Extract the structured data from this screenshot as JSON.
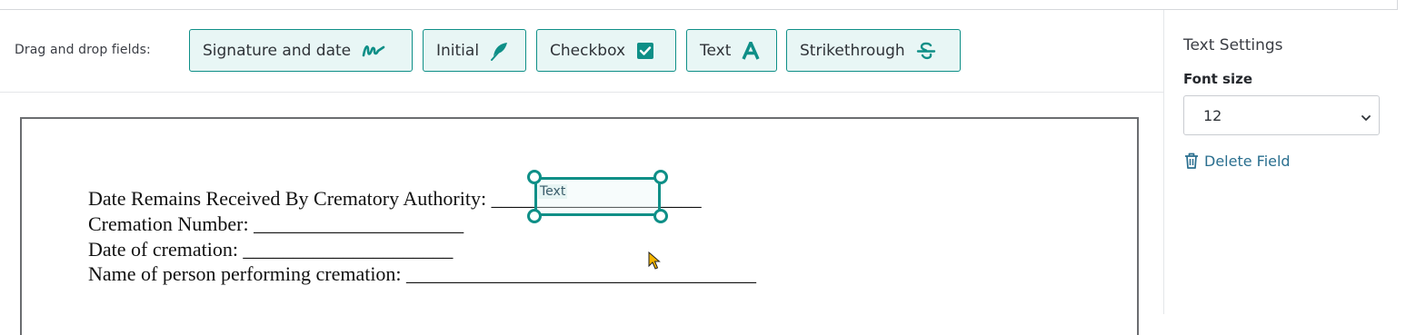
{
  "toolbar": {
    "label": "Drag and drop fields:",
    "fields": [
      {
        "label": "Signature and date",
        "icon": "signature-icon"
      },
      {
        "label": "Initial",
        "icon": "feather-icon"
      },
      {
        "label": "Checkbox",
        "icon": "checkbox-icon"
      },
      {
        "label": "Text",
        "icon": "text-a-icon"
      },
      {
        "label": "Strikethrough",
        "icon": "strikethrough-icon"
      }
    ]
  },
  "document": {
    "lines": [
      "Date Remains Received By Crematory Authority: _____________________",
      "Cremation Number: _____________________",
      "Date of cremation: _____________________",
      "Name of person performing cremation: ___________________________________"
    ],
    "placed_field": {
      "type": "Text",
      "placeholder": "Text"
    }
  },
  "settings": {
    "title": "Text Settings",
    "font_size_label": "Font size",
    "font_size_value": "12",
    "delete_label": "Delete Field"
  },
  "colors": {
    "accent": "#0e8f87",
    "button_bg": "#e8f6f5",
    "link": "#2a6f8f",
    "cursor": "#f4b400"
  }
}
